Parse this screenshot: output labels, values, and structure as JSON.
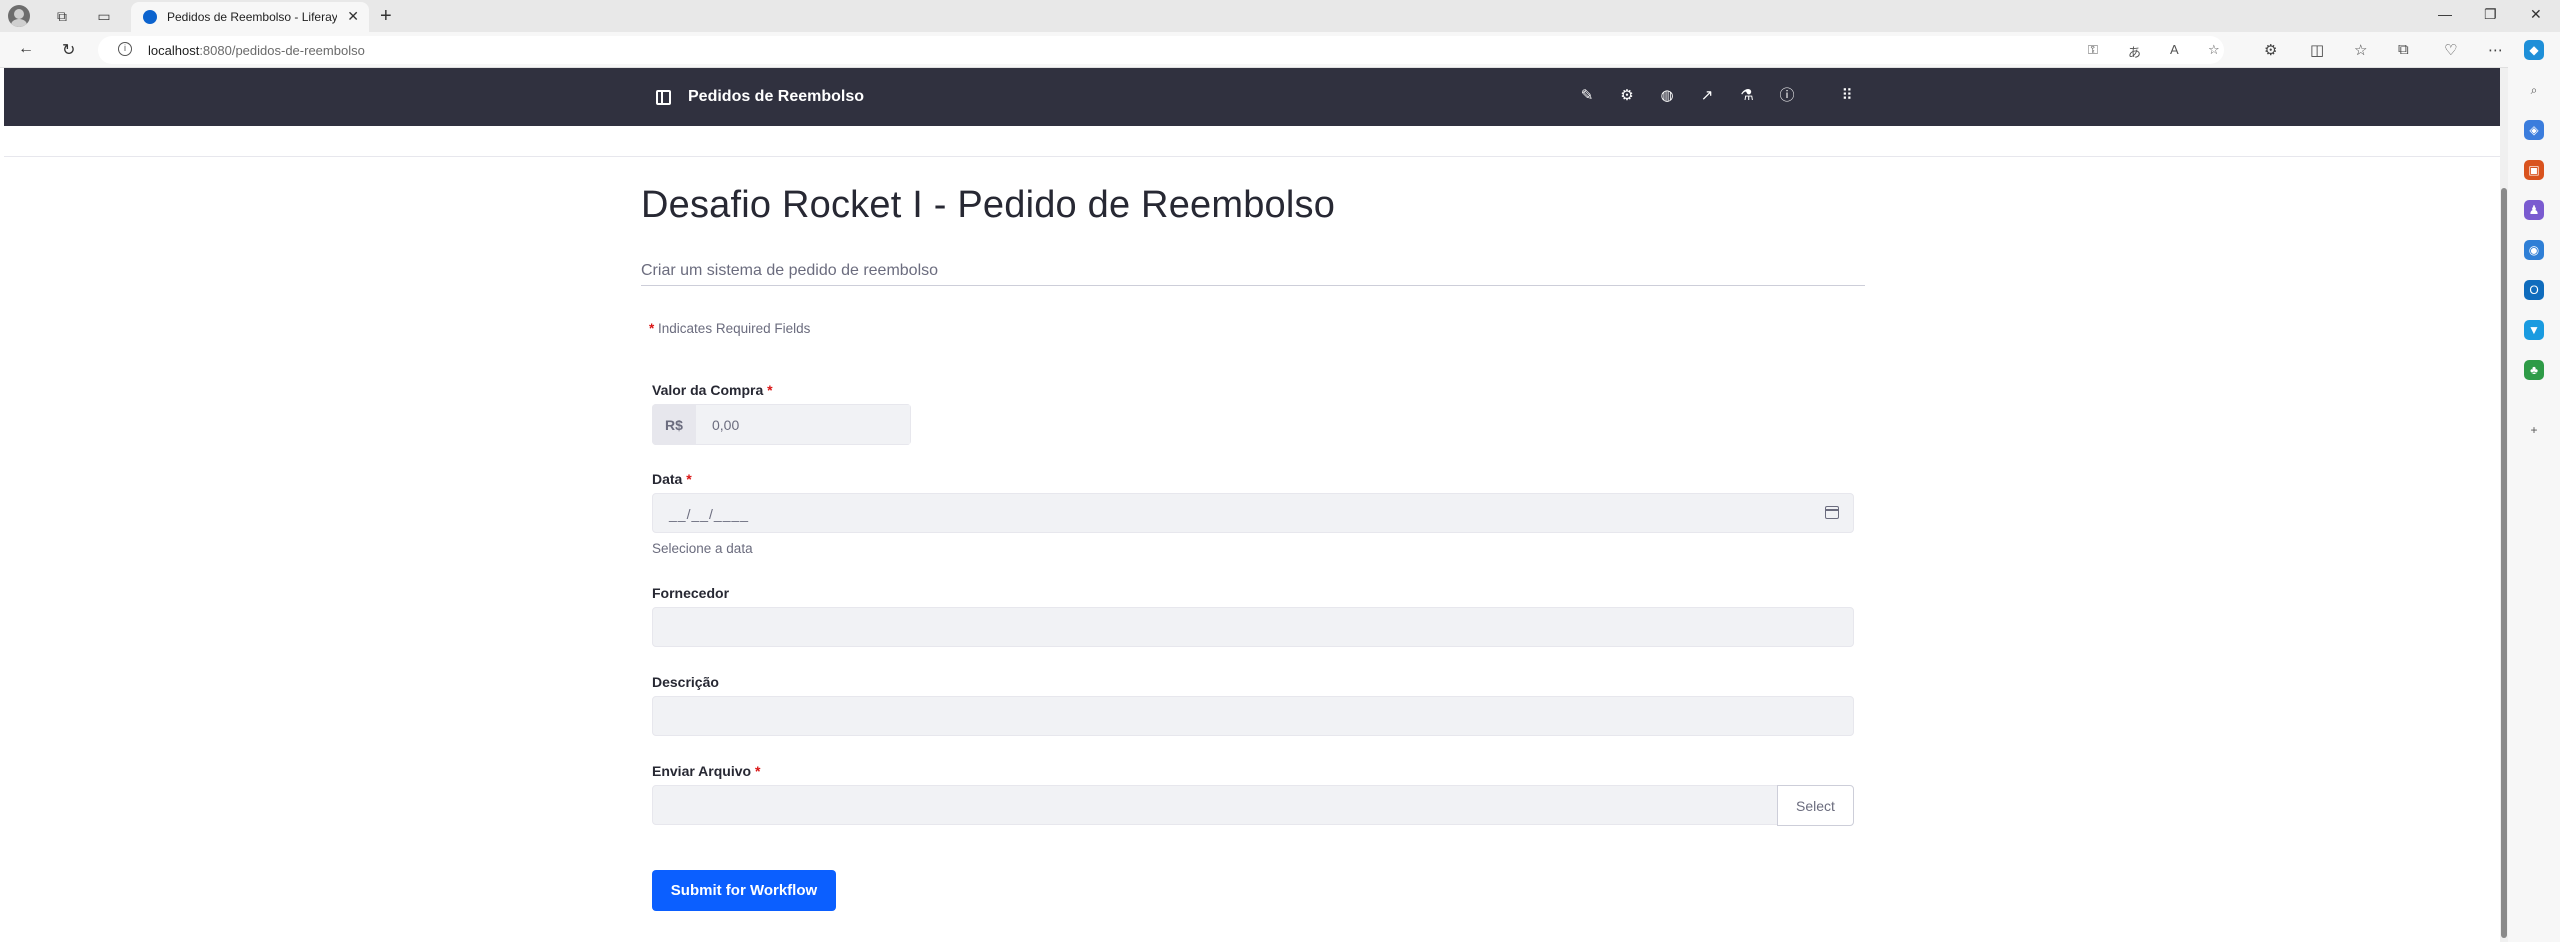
{
  "browser": {
    "tab_title": "Pedidos de Reembolso - Liferay D",
    "url_host": "localhost",
    "url_rest": ":8080/pedidos-de-reembolso",
    "new_tab": "+",
    "tab_close": "✕"
  },
  "control_menu": {
    "title": "Pedidos de Reembolso",
    "icons": [
      "pencil-icon",
      "gear-icon",
      "globe-icon",
      "analytics-icon",
      "flask-icon",
      "info-icon",
      "apps-grid-icon"
    ]
  },
  "form": {
    "title": "Desafio Rocket I - Pedido de Reembolso",
    "description": "Criar um sistema de pedido de reembolso",
    "required_star": "*",
    "required_note": "Indicates Required Fields",
    "fields": {
      "valor": {
        "label": "Valor da Compra",
        "prefix": "R$",
        "placeholder": "0,00"
      },
      "data": {
        "label": "Data",
        "mask": "__/__/____",
        "help": "Selecione a data"
      },
      "fornecedor": {
        "label": "Fornecedor"
      },
      "descricao": {
        "label": "Descrição"
      },
      "arquivo": {
        "label": "Enviar Arquivo",
        "button": "Select"
      }
    },
    "submit_label": "Submit for Workflow"
  },
  "colors": {
    "control_menu_bg": "#30313f",
    "primary": "#0b5fff",
    "required": "#da1414",
    "input_bg": "#f1f2f5"
  }
}
